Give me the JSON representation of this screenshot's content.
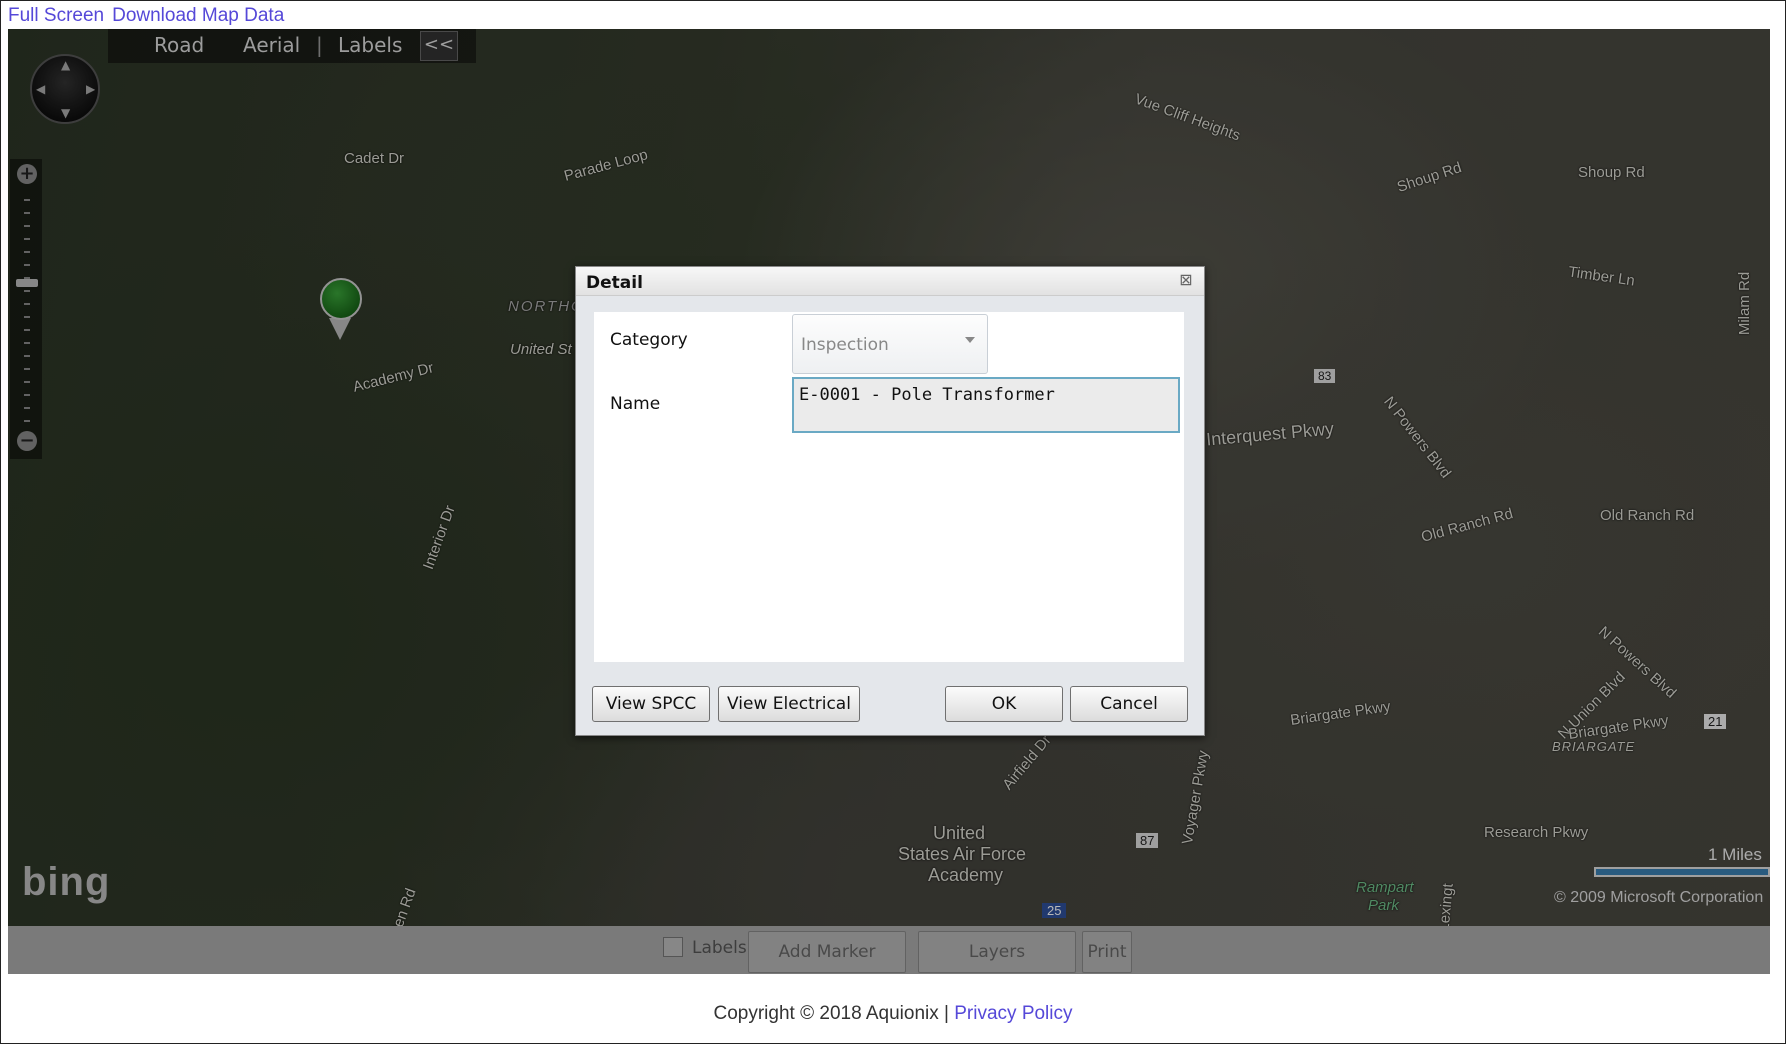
{
  "top_links": {
    "full_screen": "Full Screen",
    "download": "Download Map Data"
  },
  "map": {
    "nav": {
      "road": "Road",
      "aerial": "Aerial",
      "separator": "|",
      "labels": "Labels",
      "collapse": "<<"
    },
    "labels": [
      "Cadet Dr",
      "Parade Loop",
      "Vue Cliff Heights",
      "Shoup Rd",
      "Shoup Rd",
      "Timber Ln",
      "Milam Rd",
      "NORTHG",
      "United St",
      "Academy Dr",
      "83",
      "N Powers Blvd",
      "Interquest Pkwy",
      "Old Ranch Rd",
      "Old Ranch Rd",
      "Interior Dr",
      "N Powers Blvd",
      "N Union Blvd",
      "Briargate Pkwy",
      "Briargate Pkwy",
      "BRIARGATE",
      "21",
      "Airfield Dr",
      "Voyager Pkwy",
      "87",
      "United",
      "States Air Force",
      "Academy",
      "Research Pkwy",
      "Rampart",
      "Park",
      "25",
      "Pen Rd",
      "Lexingt"
    ],
    "bing_logo": "bing",
    "scale": "1 Miles",
    "copyright": "© 2009 Microsoft Corporation"
  },
  "bottom_bar": {
    "labels": "Labels",
    "add_marker": "Add Marker",
    "layers": "Layers",
    "print": "Print"
  },
  "footer": {
    "copyright": "Copyright © 2018 Aquionix |",
    "privacy": "Privacy Policy"
  },
  "dialog": {
    "title": "Detail",
    "category_label": "Category",
    "category_value": "Inspection",
    "name_label": "Name",
    "name_value": "E-0001 - Pole Transformer",
    "view_spcc": "View SPCC",
    "view_electrical": "View Electrical",
    "ok": "OK",
    "cancel": "Cancel"
  }
}
